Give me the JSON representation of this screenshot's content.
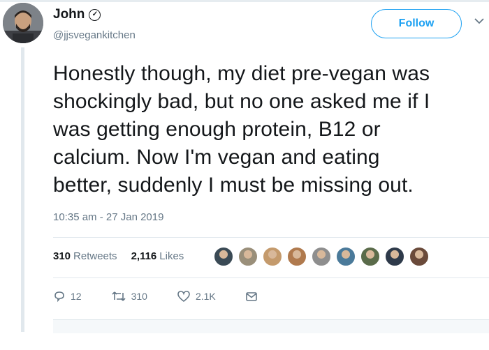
{
  "author": {
    "name": "John",
    "handle": "@jjsvegankitchen"
  },
  "header": {
    "follow_label": "Follow",
    "caret_icon": "chevron-down-icon"
  },
  "tweet": {
    "text_lines": [
      "Honestly though, my diet pre-vegan was",
      "shockingly bad, but no one asked me if I",
      "was getting enough protein, B12 or",
      "calcium. Now I'm vegan and eating",
      "better, suddenly I must be missing out."
    ],
    "timestamp": "10:35 am - 27 Jan 2019"
  },
  "stats": {
    "retweets_count": "310",
    "retweets_label": "Retweets",
    "likes_count": "2,116",
    "likes_label": "Likes",
    "liker_avatar_colors": [
      "#3a4a55",
      "#9a8f7a",
      "#c49a6c",
      "#b07a4e",
      "#8e8e8e",
      "#4a7a9a",
      "#5a6b4a",
      "#2e3a4a",
      "#6a4a3a"
    ]
  },
  "actions": {
    "reply_count": "12",
    "retweet_count": "310",
    "like_count": "2.1K"
  },
  "colors": {
    "accent": "#1da1f2",
    "muted": "#657786",
    "text": "#14171a"
  }
}
